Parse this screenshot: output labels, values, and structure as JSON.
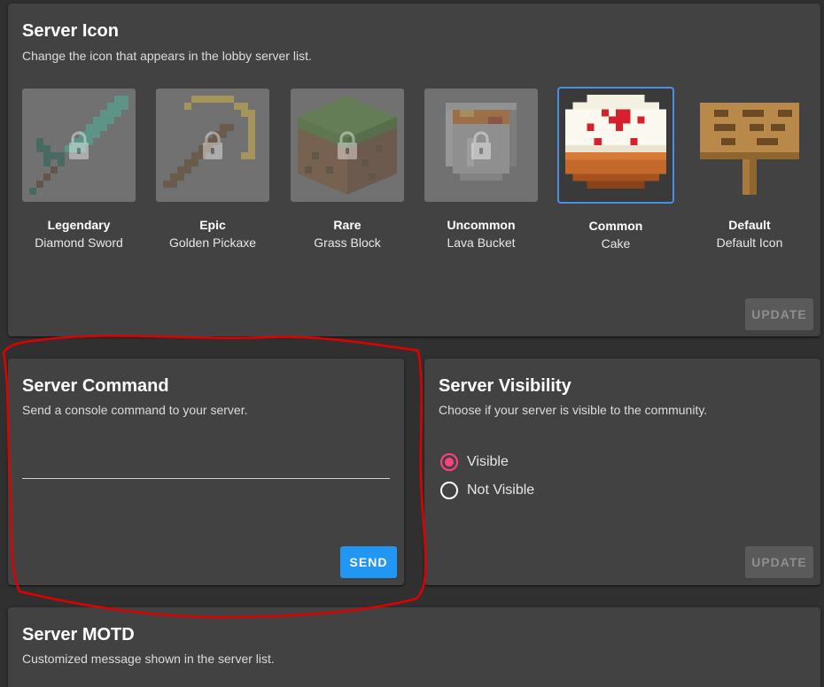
{
  "server_icon": {
    "title": "Server Icon",
    "subtitle": "Change the icon that appears in the lobby server list.",
    "update_label": "UPDATE",
    "icons": [
      {
        "tier": "Legendary",
        "name": "Diamond Sword",
        "icon": "diamond-sword-icon",
        "locked": true
      },
      {
        "tier": "Epic",
        "name": "Golden Pickaxe",
        "icon": "golden-pickaxe-icon",
        "locked": true
      },
      {
        "tier": "Rare",
        "name": "Grass Block",
        "icon": "grass-block-icon",
        "locked": true
      },
      {
        "tier": "Uncommon",
        "name": "Lava Bucket",
        "icon": "lava-bucket-icon",
        "locked": true
      },
      {
        "tier": "Common",
        "name": "Cake",
        "icon": "cake-icon",
        "locked": false,
        "selected": true
      },
      {
        "tier": "Default",
        "name": "Default Icon",
        "icon": "sign-icon",
        "locked": false
      }
    ]
  },
  "server_command": {
    "title": "Server Command",
    "subtitle": "Send a console command to your server.",
    "input_value": "",
    "send_label": "SEND"
  },
  "server_visibility": {
    "title": "Server Visibility",
    "subtitle": "Choose if your server is visible to the community.",
    "options": [
      {
        "label": "Visible",
        "checked": true
      },
      {
        "label": "Not Visible",
        "checked": false
      }
    ],
    "update_label": "UPDATE"
  },
  "server_motd": {
    "title": "Server MOTD",
    "subtitle": "Customized message shown in the server list."
  },
  "colors": {
    "background": "#303030",
    "card": "#424242",
    "accent_blue": "#2196f3",
    "radio_pink": "#ff4081",
    "annotation_red": "#e00000"
  }
}
